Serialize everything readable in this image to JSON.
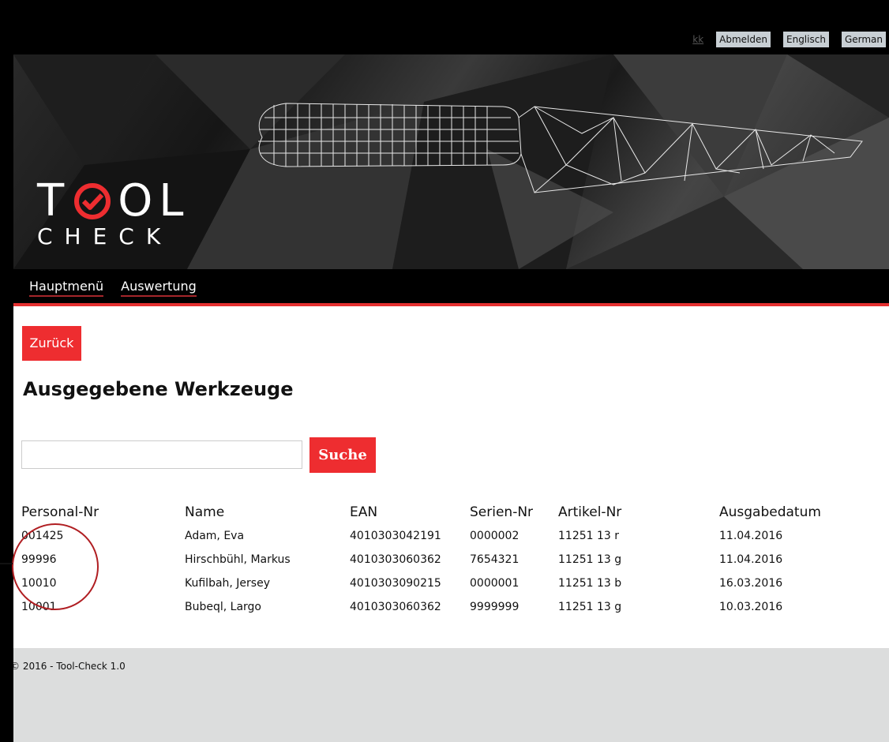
{
  "header": {
    "user": "kk",
    "logout_label": "Abmelden",
    "lang_english": "Englisch",
    "lang_german": "German",
    "logo_top": "T",
    "logo_rest": "OL",
    "logo_bottom": "CHECK",
    "brand_color": "#ee2d30"
  },
  "nav": {
    "items": [
      {
        "label": "Hauptmenü"
      },
      {
        "label": "Auswertung"
      }
    ]
  },
  "main": {
    "back_label": "Zurück",
    "title": "Ausgegebene Werkzeuge",
    "search_value": "",
    "search_label": "Suche"
  },
  "table": {
    "columns": [
      "Personal-Nr",
      "Name",
      "EAN",
      "Serien-Nr",
      "Artikel-Nr",
      "Ausgabedatum"
    ],
    "rows": [
      [
        "001425",
        "Adam, Eva",
        "4010303042191",
        "0000002",
        "11251 13 r",
        "11.04.2016"
      ],
      [
        "99996",
        "Hirschbühl, Markus",
        "4010303060362",
        "7654321",
        "11251 13 g",
        "11.04.2016"
      ],
      [
        "10010",
        "Kufilbah, Jersey",
        "4010303090215",
        "0000001",
        "11251 13 b",
        "16.03.2016"
      ],
      [
        "10001",
        "Bubeql, Largo",
        "4010303060362",
        "9999999",
        "11251 13 g",
        "10.03.2016"
      ]
    ]
  },
  "footer": {
    "copyright": "© 2016 - Tool-Check 1.0"
  }
}
